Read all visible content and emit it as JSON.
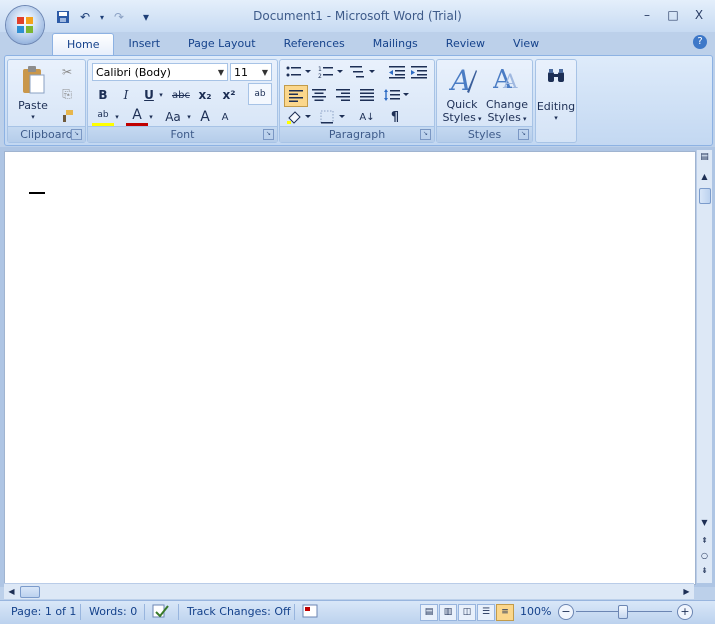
{
  "window": {
    "title": "Document1 - Microsoft Word (Trial)",
    "minimize": "–",
    "maximize": "□",
    "close": "X"
  },
  "qat": {
    "save": "💾",
    "undo": "↶",
    "redo": "↷",
    "customize": "▾"
  },
  "tabs": [
    "Home",
    "Insert",
    "Page Layout",
    "References",
    "Mailings",
    "Review",
    "View"
  ],
  "help_icon": "?",
  "ribbon": {
    "clipboard": {
      "label": "Clipboard",
      "paste": "Paste",
      "cut": "✂",
      "copy": "⎘",
      "format_painter": "🖌"
    },
    "font": {
      "label": "Font",
      "font_name": "Calibri (Body)",
      "font_size": "11",
      "clear": "ab",
      "bold": "B",
      "italic": "I",
      "underline": "U",
      "strike": "abc",
      "subscript": "x₂",
      "superscript": "x²",
      "highlight": "ab",
      "font_color": "A",
      "change_case": "Aa",
      "grow": "A",
      "shrink": "A"
    },
    "paragraph": {
      "label": "Paragraph",
      "show_marks": "¶",
      "sort": "A↓"
    },
    "styles": {
      "label": "Styles",
      "quick_styles_line1": "Quick",
      "quick_styles_line2": "Styles",
      "change_styles_line1": "Change",
      "change_styles_line2": "Styles"
    },
    "editing": {
      "label": "Editing"
    }
  },
  "status": {
    "page": "Page: 1 of 1",
    "words": "Words: 0",
    "track_changes": "Track Changes: Off",
    "zoom": "100%",
    "zoom_out": "−",
    "zoom_in": "+"
  },
  "colors": {
    "accent": "#15428b",
    "highlight_yellow": "#ffff00",
    "font_color_red": "#c00000",
    "active_view": "#fbd78c"
  }
}
